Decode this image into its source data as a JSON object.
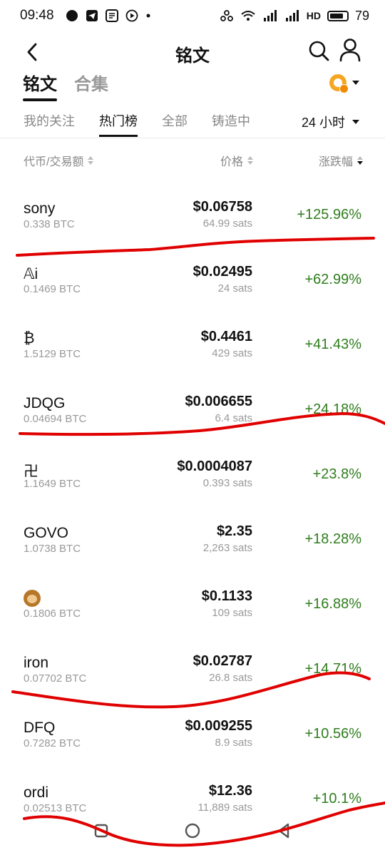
{
  "status_bar": {
    "time": "09:48",
    "battery": "79",
    "network": "HD"
  },
  "nav": {
    "title": "铭文"
  },
  "top_tabs": [
    {
      "label": "铭文",
      "active": true
    },
    {
      "label": "合集",
      "active": false
    }
  ],
  "sub_tabs": [
    {
      "label": "我的关注",
      "active": false
    },
    {
      "label": "热门榜",
      "active": true
    },
    {
      "label": "全部",
      "active": false
    },
    {
      "label": "铸造中",
      "active": false
    }
  ],
  "time_filter": "24 小时",
  "columns": {
    "name": "代币/交易额",
    "price": "价格",
    "change": "涨跌幅"
  },
  "rows": [
    {
      "name": "sony",
      "volume": "0.338 BTC",
      "price": "$0.06758",
      "sats": "64.99 sats",
      "change": "+125.96%"
    },
    {
      "name": "𝔸i",
      "volume": "0.1469 BTC",
      "price": "$0.02495",
      "sats": "24 sats",
      "change": "+62.99%"
    },
    {
      "name": "₿",
      "volume": "1.5129 BTC",
      "price": "$0.4461",
      "sats": "429 sats",
      "change": "+41.43%"
    },
    {
      "name": "JDQG",
      "volume": "0.04694 BTC",
      "price": "$0.006655",
      "sats": "6.4 sats",
      "change": "+24.18%"
    },
    {
      "name": "卍",
      "volume": "1.1649 BTC",
      "price": "$0.0004087",
      "sats": "0.393 sats",
      "change": "+23.8%"
    },
    {
      "name": "GOVO",
      "volume": "1.0738 BTC",
      "price": "$2.35",
      "sats": "2,263 sats",
      "change": "+18.28%"
    },
    {
      "name": "",
      "icon": "monkey-icon",
      "volume": "0.1806 BTC",
      "price": "$0.1133",
      "sats": "109 sats",
      "change": "+16.88%"
    },
    {
      "name": "iron",
      "volume": "0.07702 BTC",
      "price": "$0.02787",
      "sats": "26.8 sats",
      "change": "+14.71%"
    },
    {
      "name": "DFQ",
      "volume": "0.7282 BTC",
      "price": "$0.009255",
      "sats": "8.9 sats",
      "change": "+10.56%"
    },
    {
      "name": "ordi",
      "volume": "0.02513 BTC",
      "price": "$12.36",
      "sats": "11,889 sats",
      "change": "+10.1%"
    }
  ],
  "colors": {
    "positive": "#2e7d1c",
    "annotation": "#e00000",
    "accent": "#f5a623"
  }
}
